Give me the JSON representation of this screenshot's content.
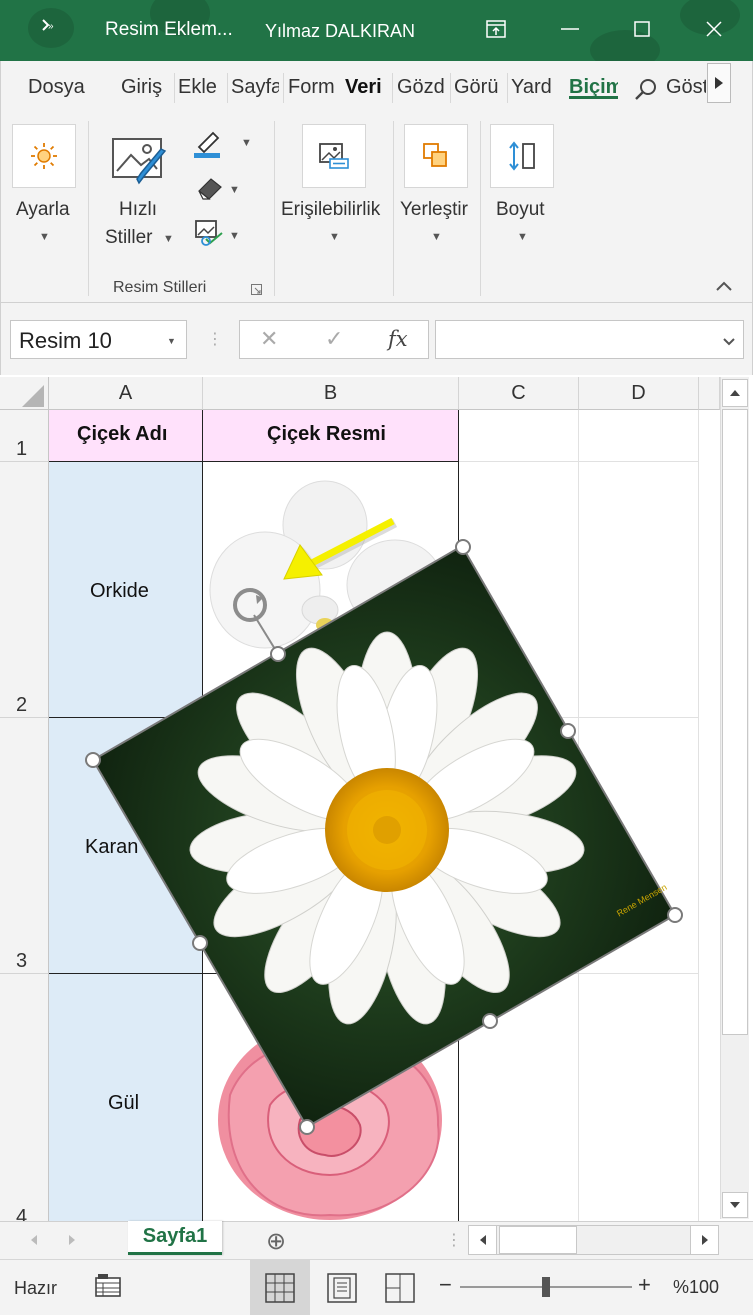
{
  "window": {
    "qat_icon": "save-excel-icon",
    "title": "Resim Eklem...",
    "user": "Yılmaz DALKIRAN",
    "restore_icon": "ribbon-display-icon",
    "minimize_icon": "minimize-icon",
    "maximize_icon": "maximize-icon",
    "close_icon": "close-icon"
  },
  "tabs": [
    "Dosya",
    "Giriş",
    "Ekle",
    "Sayfa",
    "Form",
    "Veri",
    "Gözd",
    "Görü",
    "Yard",
    "Biçim",
    "Göst"
  ],
  "tabs_active": "Biçim",
  "ribbon": {
    "ayarla": "Ayarla",
    "hizli_stiller_line1": "Hızlı",
    "hizli_stiller_line2": "Stiller",
    "erisilebilirlik": "Erişilebilirlik",
    "yerlestir": "Yerleştir",
    "boyut": "Boyut",
    "group_label": "Resim Stilleri",
    "accent": "#217346"
  },
  "formula_bar": {
    "name_box": "Resim 10",
    "cancel_icon": "✕",
    "enter_icon": "✓",
    "fx_label": "fx",
    "formula": ""
  },
  "grid": {
    "columns": [
      "A",
      "B",
      "C",
      "D"
    ],
    "rows": [
      "1",
      "2",
      "3",
      "4"
    ],
    "header_a": "Çiçek Adı",
    "header_b": "Çiçek Resmi",
    "names": [
      "Orkide",
      "Karan",
      "Gül"
    ],
    "header_fill": "#ffe1fb",
    "name_fill": "#ddebf7"
  },
  "picture": {
    "watermark": "Rene Mensen"
  },
  "sheets": {
    "active": "Sayfa1",
    "add_icon": "⊕"
  },
  "status": {
    "ready": "Hazır",
    "zoom": "%100",
    "zoom_minus": "−",
    "zoom_plus": "+"
  }
}
